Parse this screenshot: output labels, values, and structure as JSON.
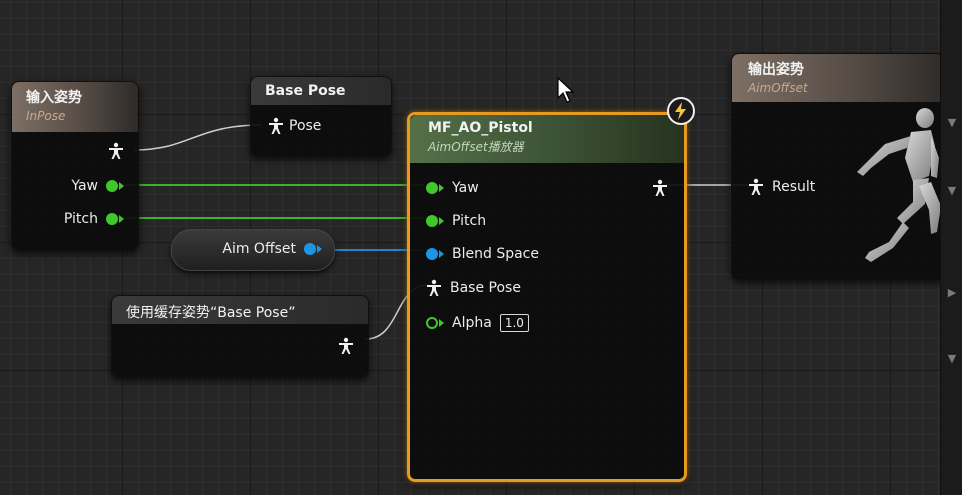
{
  "nodes": {
    "input_pose": {
      "title": "输入姿势",
      "subtitle": "InPose",
      "pins": {
        "yaw": "Yaw",
        "pitch": "Pitch"
      }
    },
    "base_pose": {
      "title": "Base Pose",
      "pin": "Pose"
    },
    "aim_offset_var": {
      "label": "Aim Offset"
    },
    "cached_pose": {
      "title": "使用缓存姿势“Base Pose”"
    },
    "mf_ao_pistol": {
      "title": "MF_AO_Pistol",
      "subtitle": "AimOffset播放器",
      "pins": {
        "yaw": "Yaw",
        "pitch": "Pitch",
        "blend_space": "Blend Space",
        "base_pose": "Base Pose",
        "alpha": "Alpha"
      },
      "alpha_value": "1.0"
    },
    "output_pose": {
      "title": "输出姿势",
      "subtitle": "AimOffset",
      "pin": "Result"
    }
  },
  "icons": {
    "pose_pin": "person-pose-icon",
    "lightning": "lightning-icon",
    "mannequin": "running-mannequin-icon",
    "cursor": "mouse-cursor-icon",
    "scroll_arrows": [
      "scroll-up-icon",
      "scroll-down-icon",
      "scroll-right-icon",
      "scroll-down-icon"
    ]
  },
  "colors": {
    "float_pin": "#3ec82a",
    "object_pin": "#1d95e6",
    "selection_outline": "#e69a1f",
    "pose_wire": "#cfcfcf"
  }
}
